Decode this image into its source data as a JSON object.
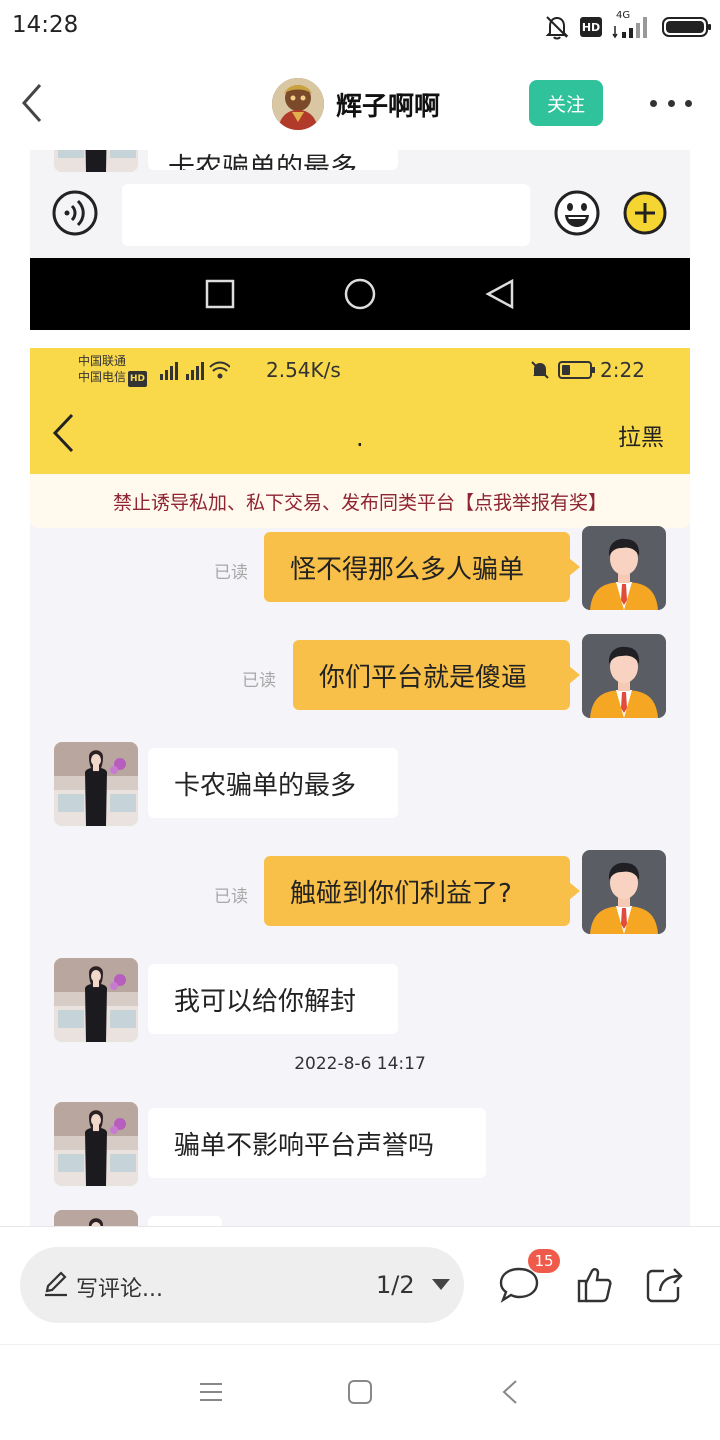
{
  "status_bar": {
    "time": "14:28",
    "hd": "HD",
    "network": "4G"
  },
  "header": {
    "author_name": "辉子啊啊",
    "follow_label": "关注"
  },
  "screenshot": {
    "top_bubble_text": "卡农骗单的最多",
    "inner_status": {
      "carrier1": "中国联通",
      "carrier2": "中国电信",
      "hd": "HD",
      "speed": "2.54K/s",
      "time": "2:22"
    },
    "chat_header": {
      "title": ".",
      "block_label": "拉黑"
    },
    "warning": "禁止诱导私加、私下交易、发布同类平台【点我举报有奖】",
    "messages": [
      {
        "side": "out",
        "text": "怪不得那么多人骗单",
        "read": "已读"
      },
      {
        "side": "out",
        "text": "你们平台就是傻逼",
        "read": "已读"
      },
      {
        "side": "in",
        "text": "卡农骗单的最多"
      },
      {
        "side": "out",
        "text": "触碰到你们利益了?",
        "read": "已读"
      },
      {
        "side": "in",
        "text": "我可以给你解封"
      },
      {
        "side": "in",
        "text": "骗单不影响平台声誉吗"
      }
    ],
    "timestamp": "2022-8-6 14:17"
  },
  "actions": {
    "comment_placeholder": "写评论...",
    "page_indicator": "1/2",
    "comment_count": "15"
  },
  "colors": {
    "follow_green": "#2fc29b",
    "inner_header_yellow": "#f9d94a",
    "outgoing_bubble": "#f8c048",
    "warning_text": "#8f2432",
    "badge_red": "#f05a4a"
  }
}
